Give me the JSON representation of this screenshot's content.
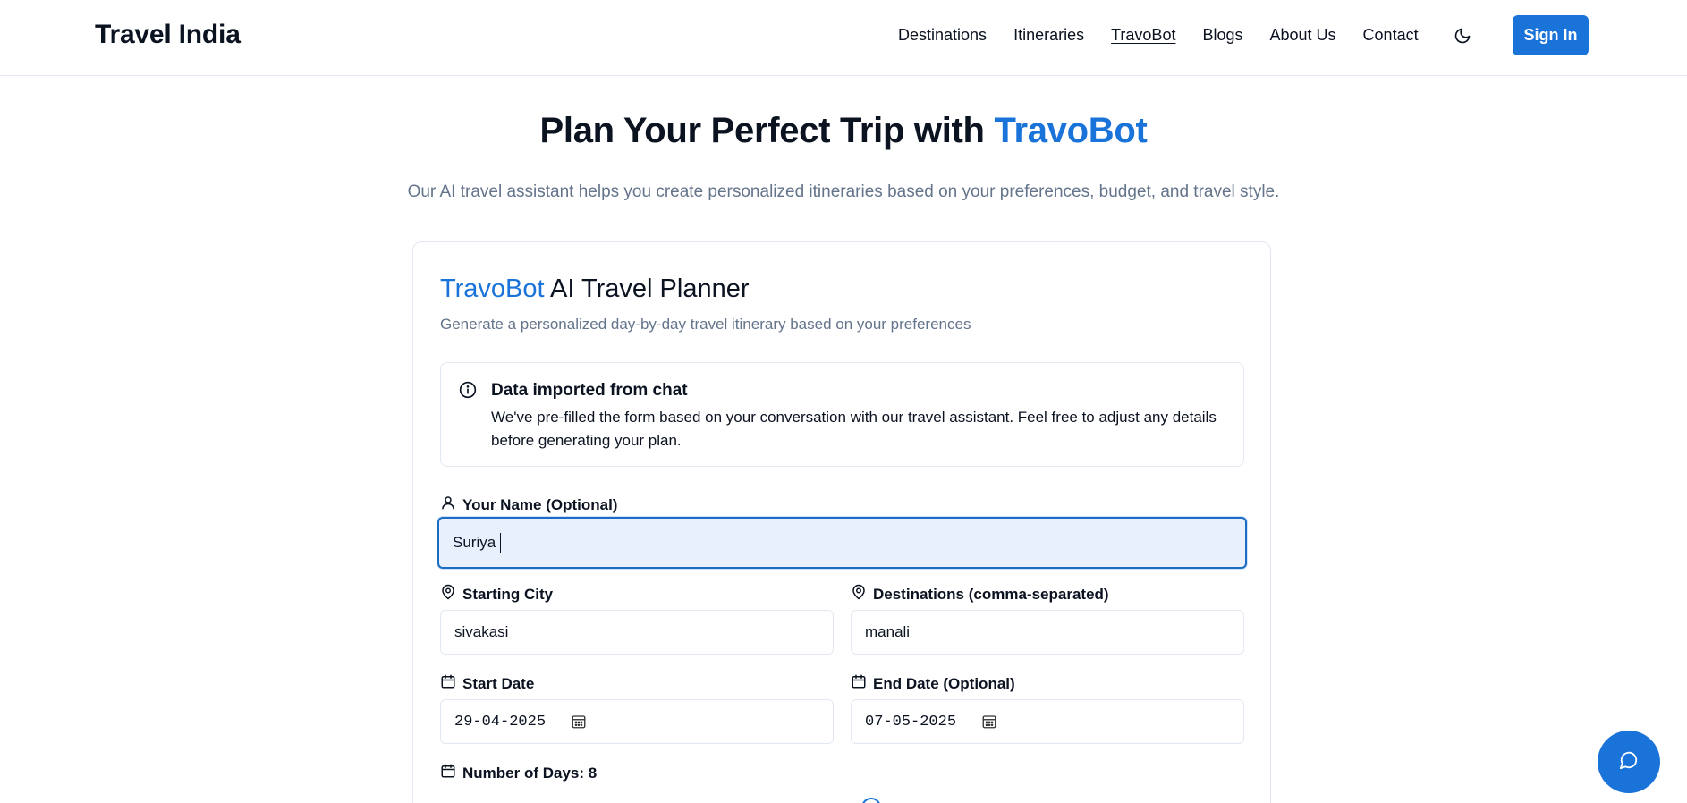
{
  "header": {
    "logo": "Travel India",
    "nav": [
      "Destinations",
      "Itineraries",
      "TravoBot",
      "Blogs",
      "About Us",
      "Contact"
    ],
    "active_nav": "TravoBot",
    "signin_label": "Sign In"
  },
  "hero": {
    "title_prefix": "Plan Your Perfect Trip with ",
    "title_accent": "TravoBot",
    "subtitle": "Our AI travel assistant helps you create personalized itineraries based on your preferences, budget, and travel style."
  },
  "planner": {
    "title_accent": "TravoBot",
    "title_rest": " AI Travel Planner",
    "description": "Generate a personalized day-by-day travel itinerary based on your preferences",
    "notice": {
      "title": "Data imported from chat",
      "body": "We've pre-filled the form based on your conversation with our travel assistant. Feel free to adjust any details before generating your plan."
    },
    "name": {
      "label": "Your Name (Optional)",
      "value": "Suriya"
    },
    "starting_city": {
      "label": "Starting City",
      "value": "sivakasi"
    },
    "destinations": {
      "label": "Destinations (comma-separated)",
      "value": "manali"
    },
    "start_date": {
      "label": "Start Date",
      "value": "29-04-2025"
    },
    "end_date": {
      "label": "End Date (Optional)",
      "value": "07-05-2025"
    },
    "days": {
      "label": "Number of Days: 8"
    }
  },
  "colors": {
    "accent": "#1a73d9",
    "muted": "#64748b",
    "border": "#e2e8f0",
    "focus_bg": "#e8f0fe"
  },
  "icons": {
    "theme": "moon-icon",
    "info": "info-icon",
    "user": "user-icon",
    "location": "map-pin-icon",
    "calendar": "calendar-icon",
    "chat": "chat-bubble-icon"
  }
}
